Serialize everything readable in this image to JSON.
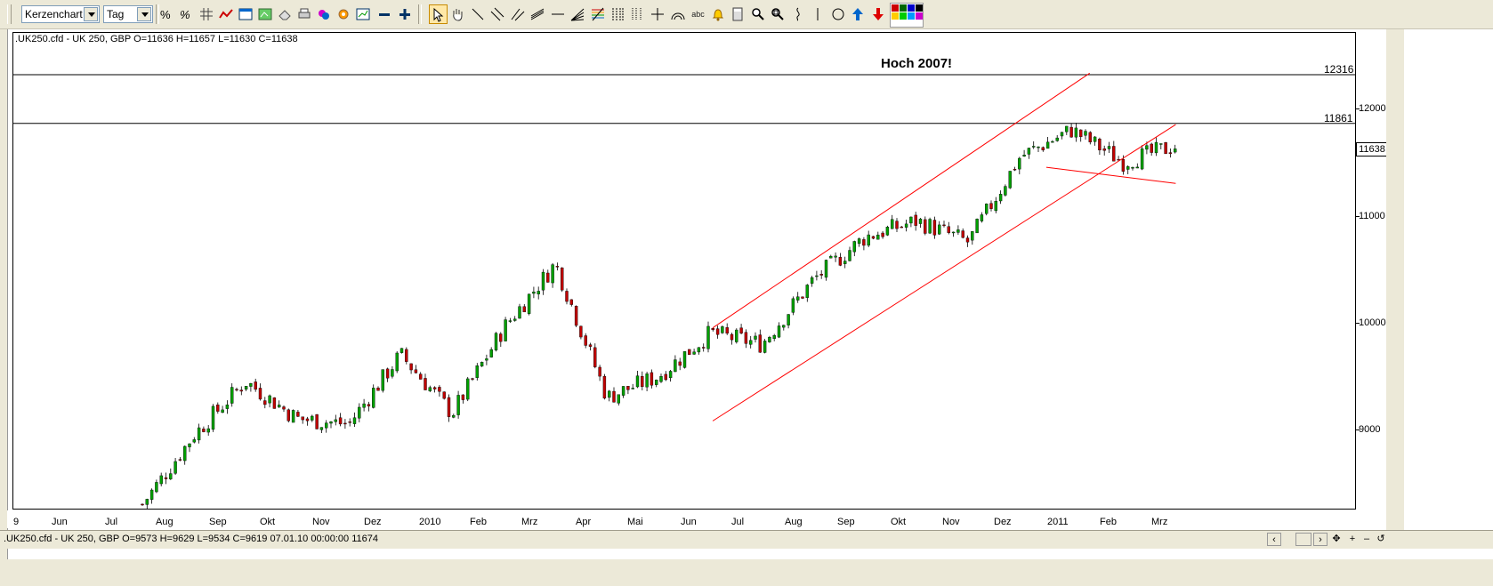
{
  "toolbar": {
    "chart_type": "Kerzenchart",
    "interval": "Tag",
    "button_texts": {
      "abc": "abc"
    }
  },
  "chart": {
    "info_line": ".UK250.cfd - UK 250, GBP O=11636 H=11657 L=11630 C=11638",
    "annotation": "Hoch 2007!",
    "level_high": "12316",
    "level_mid": "11861",
    "last_price": "11638",
    "y_ticks": [
      "12000",
      "11000",
      "10000",
      "9000"
    ],
    "x_ticks": [
      "9",
      "Jun",
      "Jul",
      "Aug",
      "Sep",
      "Okt",
      "Nov",
      "Dez",
      "2010",
      "Feb",
      "Mrz",
      "Apr",
      "Mai",
      "Jun",
      "Jul",
      "Aug",
      "Sep",
      "Okt",
      "Nov",
      "Dez",
      "2011",
      "Feb",
      "Mrz"
    ]
  },
  "status": {
    "text": ".UK250.cfd - UK 250, GBP O=9573 H=9629 L=9534 C=9619   07.01.10 00:00:00 11674"
  },
  "chart_data": {
    "type": "candlestick",
    "title": ".UK250.cfd - UK 250, GBP O=11636 H=11657 L=11630 C=11638",
    "annotations": [
      "Hoch 2007!"
    ],
    "horizontal_levels": [
      12316,
      11861
    ],
    "last_price": 11638,
    "y_ticks": [
      12000,
      11000,
      10000,
      9000
    ],
    "ylim": [
      8250,
      12700
    ],
    "x_ticks": [
      "9",
      "Jun",
      "Jul",
      "Aug",
      "Sep",
      "Okt",
      "Nov",
      "Dez",
      "2010",
      "Feb",
      "Mrz",
      "Apr",
      "Mai",
      "Jun",
      "Jul",
      "Aug",
      "Sep",
      "Okt",
      "Nov",
      "Dez",
      "2011",
      "Feb",
      "Mrz"
    ],
    "trend_lines": [
      {
        "name": "channel-upper",
        "from": [
          "2010-06-15",
          9950
        ],
        "to": [
          "2011-01-20",
          12330
        ]
      },
      {
        "name": "channel-lower",
        "from": [
          "2010-06-15",
          9080
        ],
        "to": [
          "2011-03-10",
          11850
        ]
      },
      {
        "name": "support",
        "from": [
          "2010-12-25",
          11450
        ],
        "to": [
          "2011-03-10",
          11300
        ]
      }
    ],
    "monthly_path": [
      8300,
      8950,
      9450,
      9100,
      9050,
      9700,
      9150,
      9950,
      10550,
      9300,
      9500,
      9900,
      9800,
      10400,
      10800,
      10950,
      10750,
      11550,
      11800,
      11500,
      11650
    ]
  },
  "colors": {
    "up": "#00a000",
    "down": "#c00000",
    "trend": "#ff0000",
    "level": "#000000"
  }
}
